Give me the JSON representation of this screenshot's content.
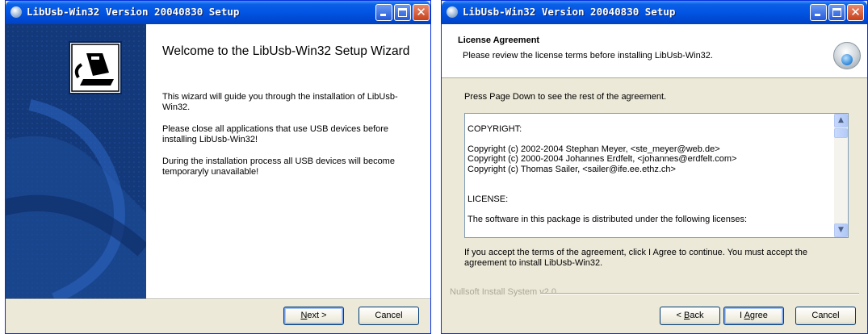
{
  "window1": {
    "title": "LibUsb-Win32 Version 20040830 Setup",
    "welcome_title": "Welcome to the LibUsb-Win32 Setup Wizard",
    "paragraphs": [
      "This wizard will guide you through the installation of LibUsb-Win32.",
      "Please close all applications that use USB devices before installing LibUsb-Win32!",
      "During the installation process all USB devices will become temporaryly unavailable!"
    ],
    "buttons": {
      "next_label": "Next >",
      "cancel_label": "Cancel"
    }
  },
  "window2": {
    "title": "LibUsb-Win32 Version 20040830 Setup",
    "header": {
      "title": "License Agreement",
      "subtitle": "Please review the license terms before installing LibUsb-Win32."
    },
    "intro": "Press Page Down to see the rest of the agreement.",
    "license_lines": [
      "",
      "COPYRIGHT:",
      "",
      "Copyright (c) 2002-2004 Stephan Meyer, <ste_meyer@web.de>",
      "Copyright (c) 2000-2004 Johannes Erdfelt, <johannes@erdfelt.com>",
      "Copyright (c) Thomas Sailer, <sailer@ife.ee.ethz.ch>",
      "",
      "",
      "LICENSE:",
      "",
      "The software in this package is distributed under the following licenses:"
    ],
    "accept_text": "If you accept the terms of the agreement, click I Agree to continue. You must accept the agreement to install LibUsb-Win32.",
    "branding": "Nullsoft Install System v2.0",
    "buttons": {
      "back_label": "< Back",
      "agree_label": "I Agree",
      "cancel_label": "Cancel"
    }
  },
  "colors": {
    "titlebar": "#0054e3",
    "dialog_bg": "#ece9d8",
    "side_panel": "#13397a",
    "close_button": "#d2532e"
  },
  "icons": [
    "setup-icon",
    "minimize-icon",
    "maximize-icon",
    "close-icon",
    "usb-device-icon",
    "installer-icon",
    "scroll-up-icon",
    "scroll-down-icon"
  ]
}
